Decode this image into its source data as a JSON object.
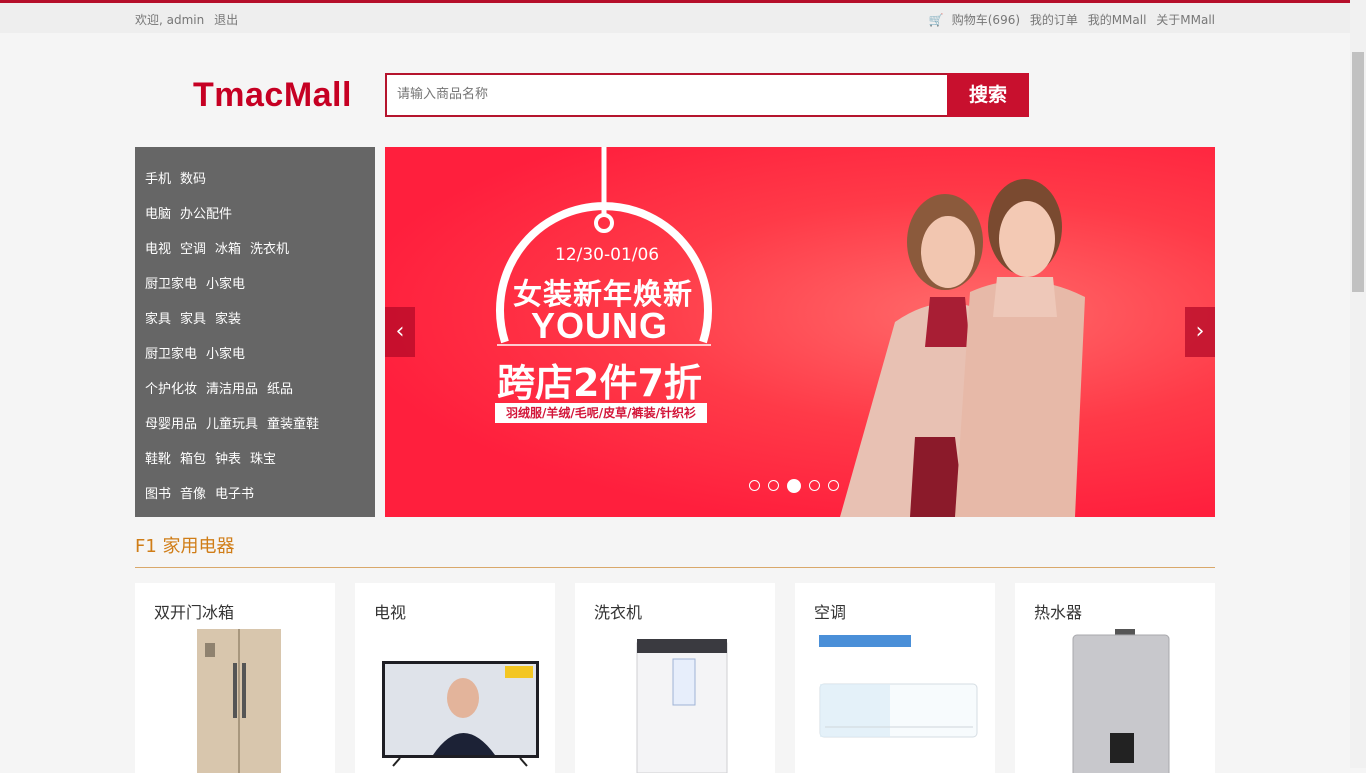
{
  "topbar": {
    "welcome": "欢迎, admin",
    "logout": "退出",
    "cart": "购物车(696)",
    "orders": "我的订单",
    "my_mall": "我的MMall",
    "about": "关于MMall"
  },
  "header": {
    "logo": "TmacMall",
    "search_placeholder": "请输入商品名称",
    "search_button": "搜索"
  },
  "categories": [
    [
      "手机",
      "数码"
    ],
    [
      "电脑",
      "办公配件"
    ],
    [
      "电视",
      "空调",
      "冰箱",
      "洗衣机"
    ],
    [
      "厨卫家电",
      "小家电"
    ],
    [
      "家具",
      "家具",
      "家装"
    ],
    [
      "厨卫家电",
      "小家电"
    ],
    [
      "个护化妆",
      "清洁用品",
      "纸品"
    ],
    [
      "母婴用品",
      "儿童玩具",
      "童装童鞋"
    ],
    [
      "鞋靴",
      "箱包",
      "钟表",
      "珠宝"
    ],
    [
      "图书",
      "音像",
      "电子书"
    ]
  ],
  "banner": {
    "date": "12/30-01/06",
    "headline": "女装新年焕新",
    "young": "YOUNG",
    "offer": "跨店2件7折",
    "tags": "羽绒服/羊绒/毛呢/皮草/裤装/针织衫",
    "slide_count": 5,
    "active_slide": 3,
    "prev_icon": "chevron-left-icon",
    "next_icon": "chevron-right-icon"
  },
  "floor": {
    "title": "F1 家用电器",
    "products": [
      {
        "name": "双开门冰箱",
        "image": "fridge"
      },
      {
        "name": "电视",
        "image": "tv"
      },
      {
        "name": "洗衣机",
        "image": "washing-machine"
      },
      {
        "name": "空调",
        "image": "air-conditioner"
      },
      {
        "name": "热水器",
        "image": "water-heater"
      }
    ]
  },
  "colors": {
    "brand_red": "#c8102e",
    "menu_bg": "#666666",
    "floor_title": "#d07d17"
  }
}
